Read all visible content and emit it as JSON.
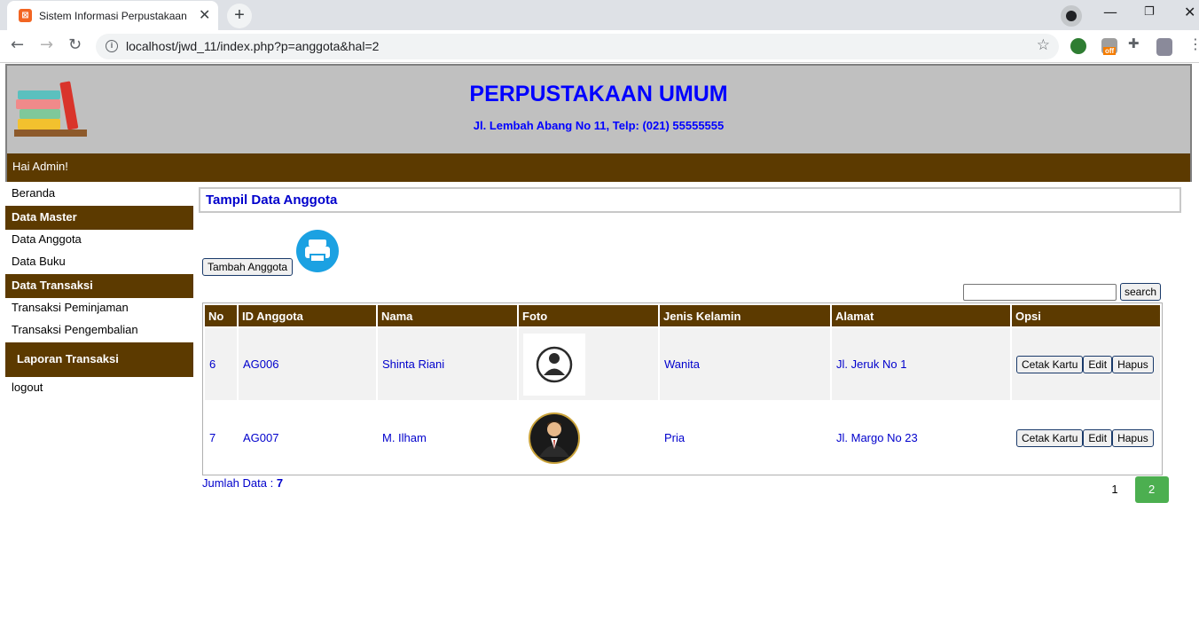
{
  "browser": {
    "tab_title": "Sistem Informasi Perpustakaan",
    "tab_favicon": "xampp-icon",
    "url": "localhost/jwd_11/index.php?p=anggota&hal=2",
    "extension_badge": "off"
  },
  "header": {
    "title": "PERPUSTAKAAN UMUM",
    "address": "Jl. Lembah Abang No 11, Telp: (021) 55555555",
    "greeting": "Hai Admin!"
  },
  "sidebar": {
    "beranda": "Beranda",
    "data_master": "Data Master",
    "data_anggota": "Data Anggota",
    "data_buku": "Data Buku",
    "data_transaksi": "Data Transaksi",
    "transaksi_peminjaman": "Transaksi Peminjaman",
    "transaksi_pengembalian": "Transaksi Pengembalian",
    "laporan_transaksi": "Laporan Transaksi",
    "logout": "logout"
  },
  "main": {
    "panel_title": "Tampil Data Anggota",
    "add_button": "Tambah Anggota",
    "search_button": "search",
    "search_value": "",
    "columns": [
      "No",
      "ID Anggota",
      "Nama",
      "Foto",
      "Jenis Kelamin",
      "Alamat",
      "Opsi"
    ],
    "rows": [
      {
        "no": "6",
        "id": "AG006",
        "nama": "Shinta Riani",
        "foto": "avatar-female-icon",
        "jk": "Wanita",
        "alamat": "Jl. Jeruk No 1"
      },
      {
        "no": "7",
        "id": "AG007",
        "nama": "M. Ilham",
        "foto": "avatar-male-suit-icon",
        "jk": "Pria",
        "alamat": "Jl. Margo No 23"
      }
    ],
    "actions": {
      "cetak": "Cetak Kartu",
      "edit": "Edit",
      "hapus": "Hapus"
    },
    "jumlah_label": "Jumlah Data :",
    "jumlah_value": "7",
    "pages": [
      "1",
      "2"
    ],
    "active_page": "2"
  },
  "colors": {
    "brown": "#5c3a00",
    "header_bg": "#c0c0c0",
    "link_blue": "#0000cc",
    "pager_active": "#4caf50"
  }
}
